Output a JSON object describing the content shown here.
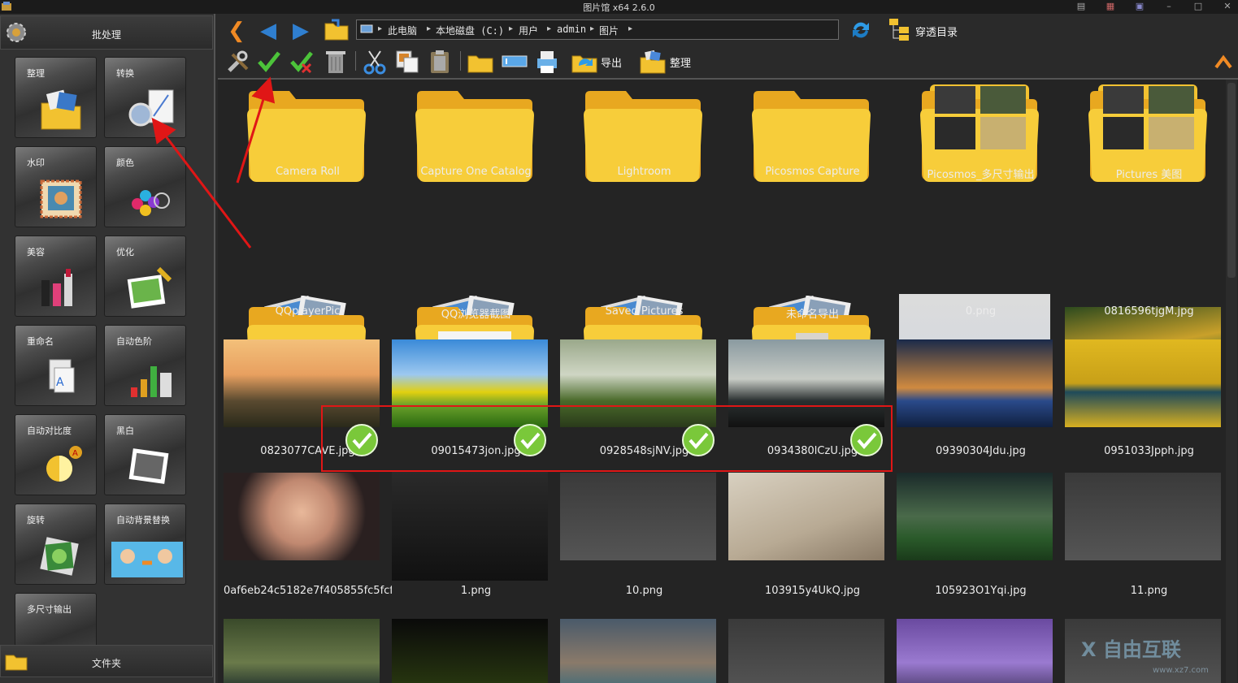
{
  "window": {
    "title": "图片馆 x64 2.6.0"
  },
  "left_panel": {
    "batch_label": "批处理",
    "folder_label": "文件夹",
    "tools": [
      {
        "label": "整理",
        "icon": "organize-icon"
      },
      {
        "label": "转换",
        "icon": "convert-icon"
      },
      {
        "label": "水印",
        "icon": "watermark-icon"
      },
      {
        "label": "颜色",
        "icon": "color-icon"
      },
      {
        "label": "美容",
        "icon": "beauty-icon"
      },
      {
        "label": "优化",
        "icon": "optimize-icon"
      },
      {
        "label": "重命名",
        "icon": "rename-icon"
      },
      {
        "label": "自动色阶",
        "icon": "auto-levels-icon"
      },
      {
        "label": "自动对比度",
        "icon": "auto-contrast-icon"
      },
      {
        "label": "黑白",
        "icon": "black-white-icon"
      },
      {
        "label": "旋转",
        "icon": "rotate-icon"
      },
      {
        "label": "自动背景替换",
        "icon": "background-replace-icon"
      },
      {
        "label": "多尺寸输出",
        "icon": "multi-size-output-icon"
      }
    ]
  },
  "address_bar": {
    "crumbs": [
      "此电脑",
      "本地磁盘 (C:)",
      "用户",
      "admin",
      "图片"
    ],
    "through_dir_label": "穿透目录"
  },
  "toolbar": {
    "export_label": "导出",
    "organize_label": "整理"
  },
  "items": [
    {
      "name": "Camera Roll",
      "kind": "folder"
    },
    {
      "name": "Capture One Catalog",
      "kind": "folder"
    },
    {
      "name": "Lightroom",
      "kind": "folder"
    },
    {
      "name": "Picosmos Capture",
      "kind": "folder"
    },
    {
      "name": "Picosmos_多尺寸输出",
      "kind": "folder-photos"
    },
    {
      "name": "Pictures 美图",
      "kind": "folder-photos"
    },
    {
      "name": "QQplayerPic",
      "kind": "folder-stack"
    },
    {
      "name": "QQ浏览器截图",
      "kind": "folder-stack"
    },
    {
      "name": "Saved Pictures",
      "kind": "folder-stack"
    },
    {
      "name": "未命名导出",
      "kind": "folder-stack"
    },
    {
      "name": "0.png",
      "kind": "image"
    },
    {
      "name": "0816596tjgM.jpg",
      "kind": "image"
    },
    {
      "name": "0823077CAVE.jpg",
      "kind": "image",
      "checked": true
    },
    {
      "name": "09015473jon.jpg",
      "kind": "image",
      "checked": true
    },
    {
      "name": "0928548sjNV.jpg",
      "kind": "image",
      "checked": true
    },
    {
      "name": "0934380lCzU.jpg",
      "kind": "image",
      "checked": true
    },
    {
      "name": "09390304Jdu.jpg",
      "kind": "image"
    },
    {
      "name": "0951033Jpph.jpg",
      "kind": "image"
    },
    {
      "name": "0af6eb24c5182e7f405855fc5fcf...",
      "kind": "image"
    },
    {
      "name": "1.png",
      "kind": "image"
    },
    {
      "name": "10.png",
      "kind": "image"
    },
    {
      "name": "103915y4UkQ.jpg",
      "kind": "image"
    },
    {
      "name": "105923O1Yqi.jpg",
      "kind": "image"
    },
    {
      "name": "11.png",
      "kind": "image"
    }
  ],
  "watermark": {
    "brand": "X 自由互联",
    "url": "www.xz7.com"
  }
}
